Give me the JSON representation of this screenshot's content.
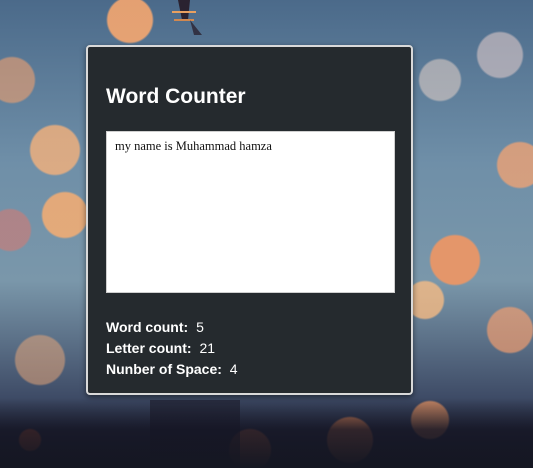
{
  "app": {
    "title": "Word Counter"
  },
  "editor": {
    "value": "my name is Muhammad hamza"
  },
  "stats": {
    "word_count_label": "Word count:",
    "word_count_value": "5",
    "letter_count_label": "Letter count:",
    "letter_count_value": "21",
    "space_count_label": "Nunber of Space:",
    "space_count_value": "4"
  },
  "colors": {
    "card_background": "#252a2e",
    "card_border": "#d9d9d9",
    "text_light": "#ffffff"
  }
}
